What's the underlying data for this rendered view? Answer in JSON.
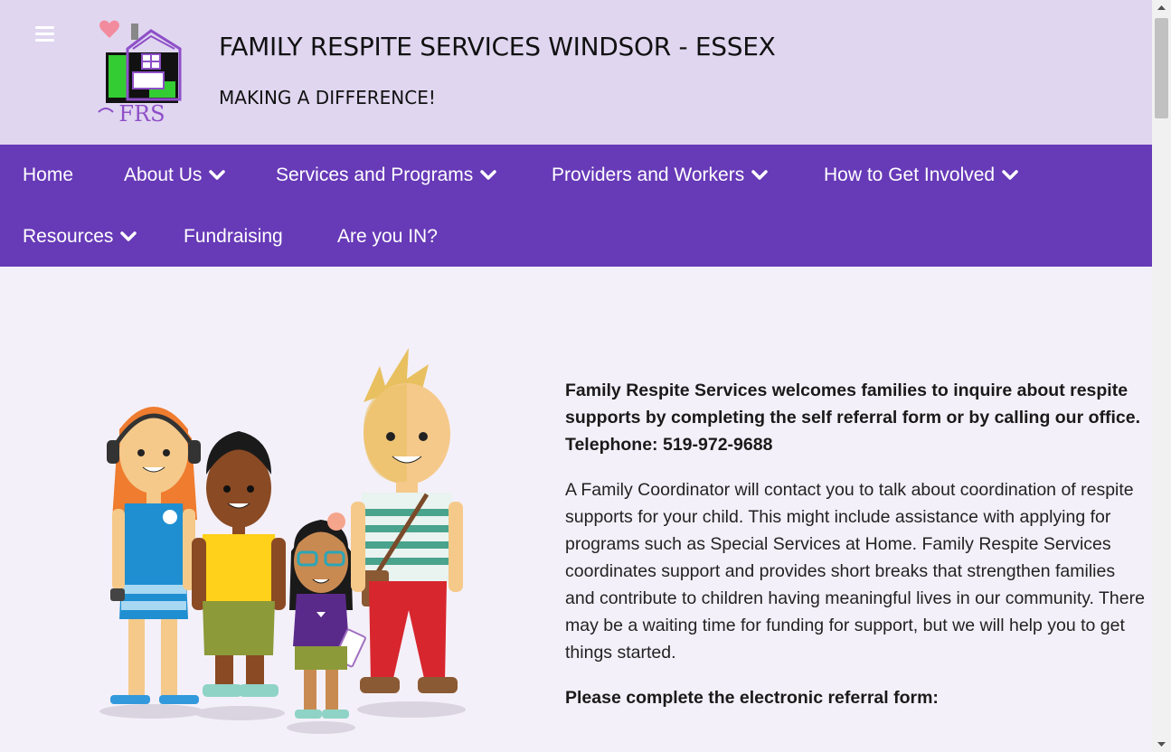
{
  "header": {
    "title": "FAMILY RESPITE SERVICES WINDSOR - ESSEX",
    "tagline": "MAKING A DIFFERENCE!",
    "logo_text": "FRS",
    "menu_icon": "hamburger-menu-icon"
  },
  "nav": {
    "items": [
      {
        "label": "Home"
      },
      {
        "label": "About Us"
      },
      {
        "label": "Services and Programs"
      },
      {
        "label": "Providers and Workers"
      },
      {
        "label": "How to Get Involved"
      },
      {
        "label": "Resources"
      },
      {
        "label": "Fundraising"
      },
      {
        "label": "Are you IN?"
      }
    ],
    "dropdown_icon": "chevron-down-icon"
  },
  "main": {
    "lead": "Family Respite Services welcomes families to inquire about respite supports by completing the self referral form or by calling our office.  Telephone: 519-972-9688",
    "body": "A Family Coordinator will contact you to talk about coordination of respite supports for your child.  This might include assistance with applying for programs such as Special Services at Home.  Family Respite Services coordinates support and provides short breaks that strengthen families and contribute to children having meaningful lives in our community.  There may be a waiting time for funding for support, but we will help you to get things started.",
    "cta": "Please complete the electronic referral form:"
  },
  "colors": {
    "header_bg": "#e0d6f0",
    "nav_bg": "#673ab7",
    "page_bg": "#f4f0f9",
    "logo_purple": "#8e4fc8",
    "logo_green": "#33cc33"
  }
}
